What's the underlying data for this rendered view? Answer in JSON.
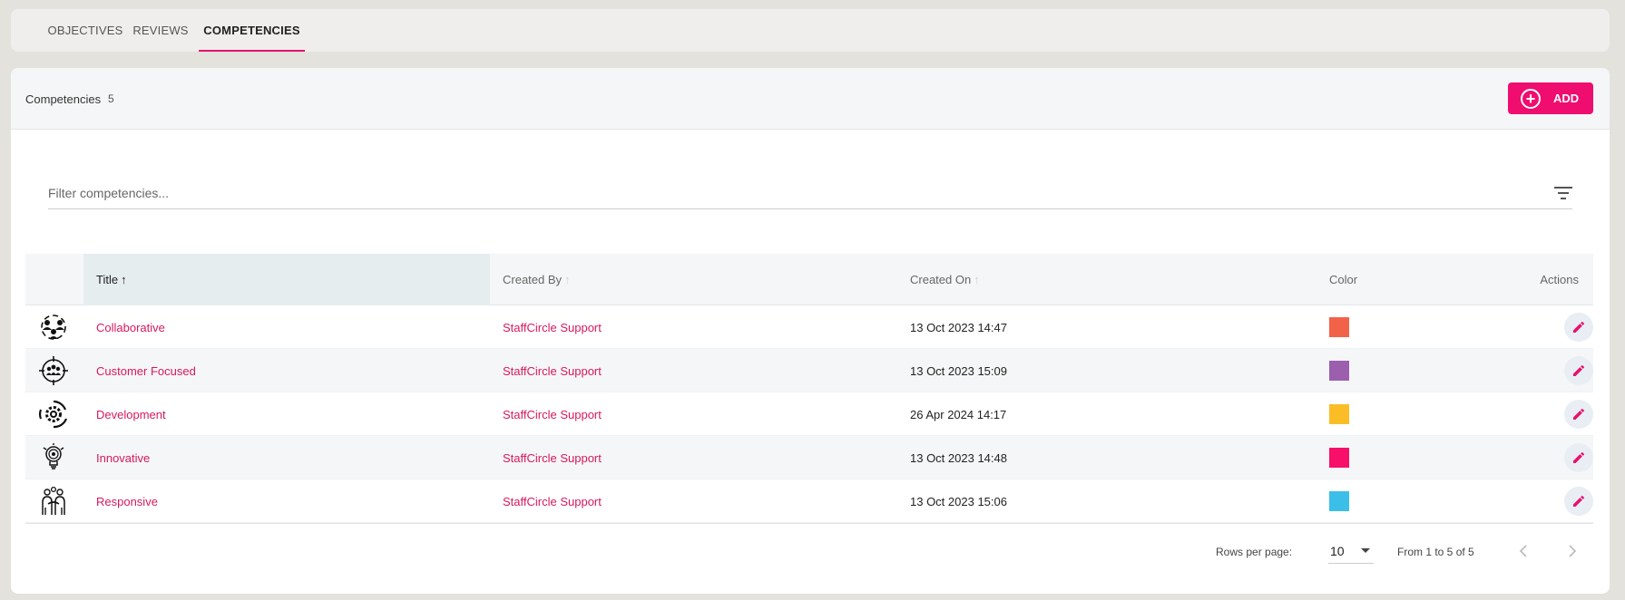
{
  "tabs": [
    {
      "label": "OBJECTIVES",
      "active": false
    },
    {
      "label": "REVIEWS",
      "active": false
    },
    {
      "label": "COMPETENCIES",
      "active": true
    }
  ],
  "header": {
    "title": "Competencies",
    "count": "5",
    "add_label": "ADD"
  },
  "filter": {
    "placeholder": "Filter competencies...",
    "value": ""
  },
  "table": {
    "columns": {
      "title": "Title",
      "created_by": "Created By",
      "created_on": "Created On",
      "color": "Color",
      "actions": "Actions"
    },
    "sort": {
      "column": "Title",
      "direction": "ascending"
    },
    "rows": [
      {
        "icon": "team-circle-icon",
        "title": "Collaborative",
        "created_by": "StaffCircle Support",
        "created_on": "13 Oct 2023 14:47",
        "color": "#f26249"
      },
      {
        "icon": "target-group-icon",
        "title": "Customer Focused",
        "created_by": "StaffCircle Support",
        "created_on": "13 Oct 2023 15:09",
        "color": "#9b5fae"
      },
      {
        "icon": "gear-cycle-icon",
        "title": "Development",
        "created_by": "StaffCircle Support",
        "created_on": "26 Apr 2024 14:17",
        "color": "#fbbd26"
      },
      {
        "icon": "lightbulb-icon",
        "title": "Innovative",
        "created_by": "StaffCircle Support",
        "created_on": "13 Oct 2023 14:48",
        "color": "#f70f6a"
      },
      {
        "icon": "handshake-people-icon",
        "title": "Responsive",
        "created_by": "StaffCircle Support",
        "created_on": "13 Oct 2023 15:06",
        "color": "#3bbfe9"
      }
    ]
  },
  "pagination": {
    "rows_per_page_label": "Rows per page:",
    "rows_per_page": "10",
    "range": "From 1 to 5 of 5"
  },
  "colors": {
    "accent": "#ef0d6f",
    "link": "#d7195d"
  }
}
